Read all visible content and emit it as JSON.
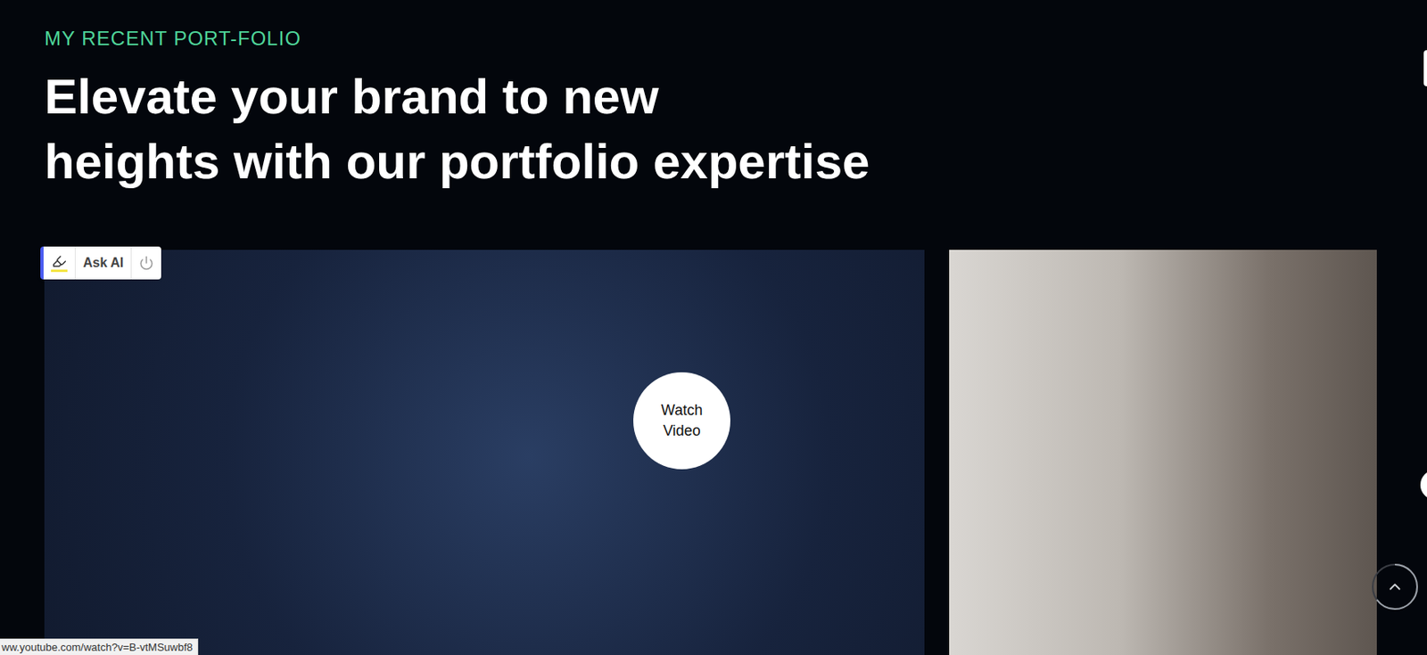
{
  "section": {
    "eyebrow": "MY RECENT PORT-FOLIO",
    "heading": [
      "Elevate your brand to new",
      "heights with our portfolio expertise"
    ]
  },
  "portfolio": [
    {
      "kind": "video",
      "watch_label": "Watch Video"
    },
    {
      "kind": "photo"
    }
  ],
  "ai_toolbar": {
    "label": "Ask AI"
  },
  "status_bar": {
    "url": "ww.youtube.com/watch?v=B-vtMSuwbf8"
  }
}
